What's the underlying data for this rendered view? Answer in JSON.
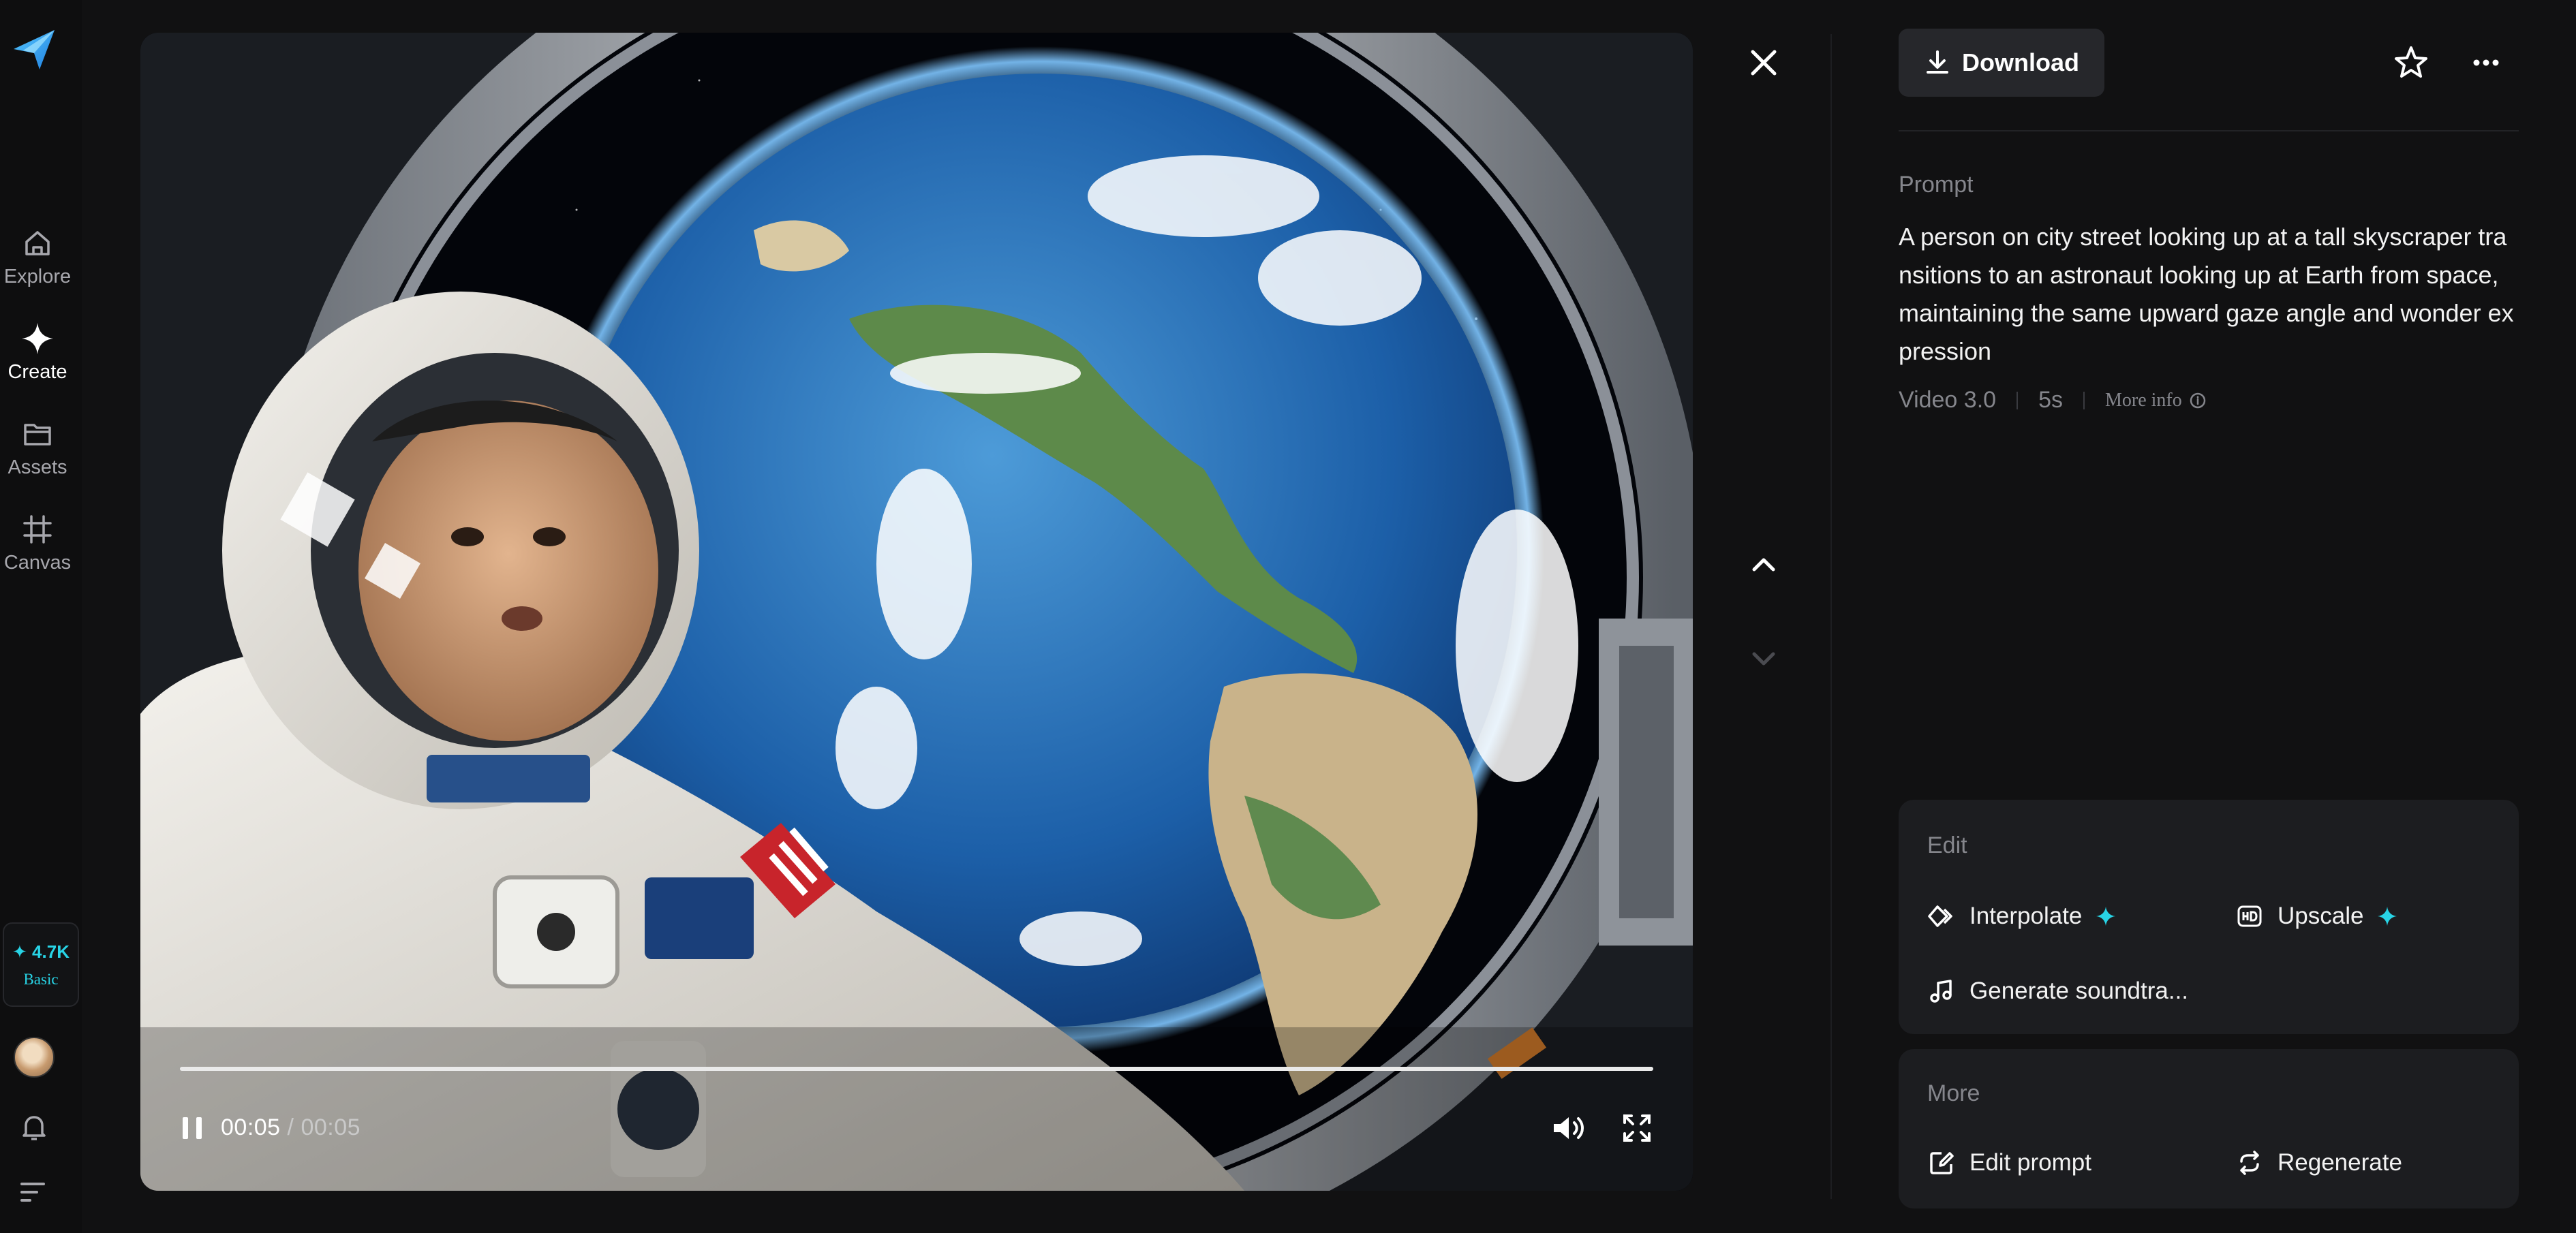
{
  "sidebar": {
    "logo_icon": "paper-plane-logo",
    "items": [
      {
        "label": "Explore",
        "icon": "home-icon",
        "active": false
      },
      {
        "label": "Create",
        "icon": "sparkle-icon",
        "active": true
      },
      {
        "label": "Assets",
        "icon": "folder-icon",
        "active": false
      },
      {
        "label": "Canvas",
        "icon": "hash-frame-icon",
        "active": false
      }
    ],
    "credits": {
      "amount": "4.7K",
      "plan": "Basic",
      "icon": "sparkle-icon"
    },
    "avatar_icon": "user-avatar",
    "notifications_icon": "bell-icon",
    "menu_icon": "menu-lines-icon"
  },
  "player": {
    "current_time": "00:05",
    "duration": "/ 00:05",
    "progress": 1.0,
    "play_state_icon": "pause-icon",
    "volume_icon": "volume-icon",
    "fullscreen_icon": "fullscreen-icon"
  },
  "viewer": {
    "close_icon": "close-icon",
    "prev_icon": "chevron-up-icon",
    "next_icon": "chevron-down-icon"
  },
  "details": {
    "download_label": "Download",
    "download_icon": "download-icon",
    "favorite_icon": "star-icon",
    "more_icon": "ellipsis-icon",
    "prompt_label": "Prompt",
    "prompt_text": "A person on city street looking up at a tall skyscraper transitions to an astronaut looking up at Earth from space, maintaining the same upward gaze angle and wonder expression",
    "model": "Video 3.0",
    "length": "5s",
    "more_info_label": "More info",
    "more_info_icon": "info-icon"
  },
  "edit_card": {
    "title": "Edit",
    "actions": [
      {
        "label": "Interpolate",
        "icon": "diamond-frames-icon",
        "premium": true
      },
      {
        "label": "Upscale",
        "icon": "hd-icon",
        "premium": true
      },
      {
        "label": "Generate soundtra...",
        "icon": "music-note-icon",
        "premium": false
      }
    ]
  },
  "more_card": {
    "title": "More",
    "actions": [
      {
        "label": "Edit prompt",
        "icon": "edit-prompt-icon"
      },
      {
        "label": "Regenerate",
        "icon": "regenerate-icon"
      }
    ]
  },
  "colors": {
    "background": "#111112",
    "panel_card": "#1c1d20",
    "accent_cyan": "#28d4e6",
    "muted_text": "#85868c"
  }
}
